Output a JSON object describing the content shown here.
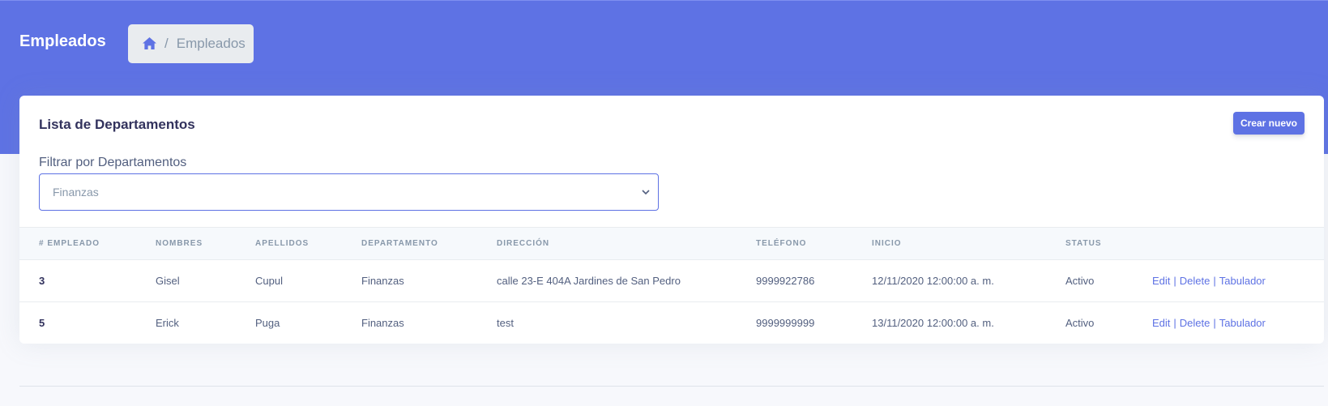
{
  "header": {
    "title": "Empleados",
    "breadcrumb": {
      "home_icon": "home-icon",
      "current": "Empleados"
    }
  },
  "card": {
    "title": "Lista de Departamentos",
    "create_button": "Crear nuevo",
    "filter": {
      "label": "Filtrar por Departamentos",
      "selected": "Finanzas"
    }
  },
  "table": {
    "headers": [
      "# Empleado",
      "Nombres",
      "Apellidos",
      "Departamento",
      "Dirección",
      "Teléfono",
      "Inicio",
      "Status",
      ""
    ],
    "rows": [
      {
        "id": "3",
        "nombres": "Gisel",
        "apellidos": "Cupul",
        "departamento": "Finanzas",
        "direccion": "calle 23-E 404A Jardines de San Pedro",
        "telefono": "9999922786",
        "inicio": "12/11/2020 12:00:00 a. m.",
        "status": "Activo",
        "actions": {
          "edit": "Edit",
          "delete": "Delete",
          "tabulador": "Tabulador"
        }
      },
      {
        "id": "5",
        "nombres": "Erick",
        "apellidos": "Puga",
        "departamento": "Finanzas",
        "direccion": "test",
        "telefono": "9999999999",
        "inicio": "13/11/2020 12:00:00 a. m.",
        "status": "Activo",
        "actions": {
          "edit": "Edit",
          "delete": "Delete",
          "tabulador": "Tabulador"
        }
      }
    ],
    "separator": "|"
  },
  "colors": {
    "primary": "#5e72e4",
    "heading": "#32325d",
    "muted": "#8898aa"
  }
}
